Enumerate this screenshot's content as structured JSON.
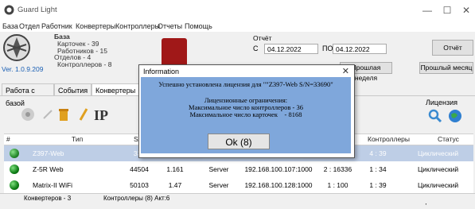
{
  "window": {
    "title": "Guard Light",
    "minimize": "—",
    "maximize": "☐",
    "close": "✕"
  },
  "menu": [
    "База",
    "Отдел",
    "Работник",
    "Конвертеры",
    "Контроллеры",
    "Отчеты",
    "Помощь"
  ],
  "info": {
    "base": "База",
    "cards": "Карточек - 39",
    "workers": "Работников - 15",
    "departments": "Отделов - 4",
    "controllers": "Контроллеров - 8",
    "version": "Ver. 1.0.9.209"
  },
  "period": {
    "label": "Отчёт",
    "from_label": "С",
    "from_date": "04.12.2022",
    "to_label": "ПО",
    "to_date": "04.12.2022",
    "report_button": "Отчёт",
    "last_week": "Прошлая неделя",
    "last_month": "Прошлый месяц"
  },
  "tabs": [
    "Работа с базой",
    "События",
    "Конвертеры"
  ],
  "license_label": "Лицензия",
  "table": {
    "headers": [
      "#",
      "Тип",
      "S/N",
      "",
      "",
      "",
      "Контроллеры",
      "Статус"
    ],
    "rows": [
      {
        "type": "Z397-Web",
        "sn": "336",
        "ver": "",
        "mode": "",
        "ip": "",
        "ctrl": "4 : 39",
        "status": "Циклический опрос",
        "selected": true
      },
      {
        "type": "Z-5R Web",
        "sn": "44504",
        "ver": "1.161",
        "mode": "Server",
        "ip": "192.168.100.107:1000",
        "port": "2 : 16336",
        "ctrl": "1 : 34",
        "status": "Циклический опрос"
      },
      {
        "type": "Matrix-II WiFi",
        "sn": "50103",
        "ver": "1.47",
        "mode": "Server",
        "ip": "192.168.100.128:1000",
        "port": "1 : 100",
        "ctrl": "1 : 39",
        "status": "Циклический опрос"
      }
    ]
  },
  "statusbar": {
    "converters": "Конвертеров - 3",
    "controllers": "Контроллеры (8) Акт:6"
  },
  "dialog": {
    "title": "Information",
    "close": "✕",
    "line1": "Успешно установлена лицензия для \"\"Z397-Web S/N=33690\"",
    "line2": "Лицензионные ограничения:",
    "line3": "Максимальное число контроллеров - 36",
    "line4": "Максимальное число карточек    - 8168",
    "ok": "Ok (8)"
  }
}
